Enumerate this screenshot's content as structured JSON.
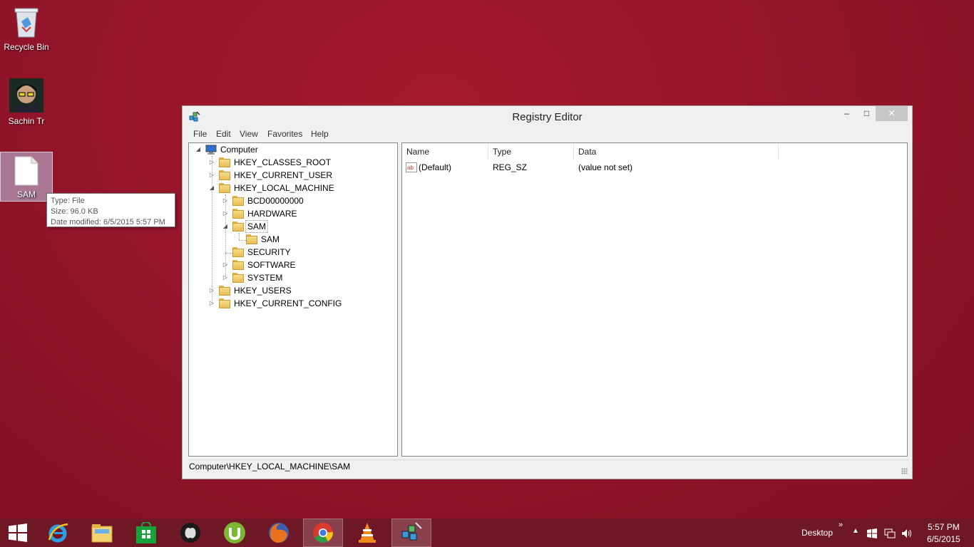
{
  "desktop": {
    "icons": [
      {
        "label": "Recycle Bin"
      },
      {
        "label": "Sachin Tr"
      },
      {
        "label": "SAM"
      }
    ],
    "tooltip": {
      "type": "Type: File",
      "size": "Size: 96.0 KB",
      "modified": "Date modified: 6/5/2015 5:57 PM"
    }
  },
  "window": {
    "title": "Registry Editor",
    "buttons": {
      "minimize": "‒",
      "maximize": "□",
      "close": "✕"
    },
    "menu": [
      "File",
      "Edit",
      "View",
      "Favorites",
      "Help"
    ],
    "tree": {
      "root": "Computer",
      "hives": {
        "classes_root": "HKEY_CLASSES_ROOT",
        "current_user": "HKEY_CURRENT_USER",
        "local_machine": "HKEY_LOCAL_MACHINE",
        "users": "HKEY_USERS",
        "current_config": "HKEY_CURRENT_CONFIG"
      },
      "local_machine_children": {
        "bcd": "BCD00000000",
        "hardware": "HARDWARE",
        "sam": "SAM",
        "sam_child": "SAM",
        "security": "SECURITY",
        "software": "SOFTWARE",
        "system": "SYSTEM"
      }
    },
    "list": {
      "columns": [
        "Name",
        "Type",
        "Data"
      ],
      "rows": [
        {
          "icon": "string-value-icon",
          "icon_text": "ab",
          "name": "(Default)",
          "type": "REG_SZ",
          "data": "(value not set)"
        }
      ]
    },
    "status": "Computer\\HKEY_LOCAL_MACHINE\\SAM"
  },
  "taskbar": {
    "apps": [
      "start-button",
      "internet-explorer-icon",
      "file-explorer-icon",
      "store-icon",
      "apple-icon",
      "utorrent-icon",
      "firefox-icon",
      "chrome-icon",
      "vlc-icon",
      "regedit-icon"
    ],
    "desktop_label": "Desktop",
    "overflow": "»",
    "time": "5:57 PM",
    "date": "6/5/2015"
  },
  "colors": {
    "desktop": "#9b162b",
    "taskbar": "#6e1825",
    "folder": "#e9bd55"
  }
}
